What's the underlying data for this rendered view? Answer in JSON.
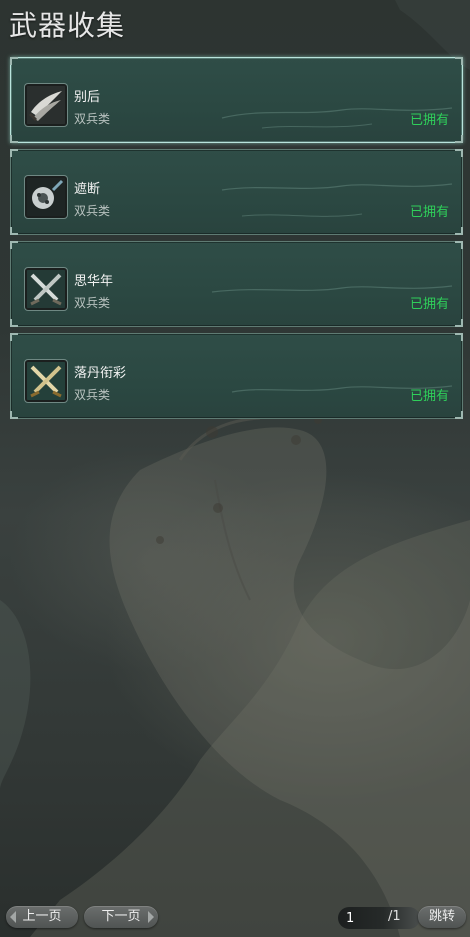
{
  "title": "武器收集",
  "weapons": [
    {
      "name": "别后",
      "type": "双兵类",
      "status": "已拥有",
      "icon": "twin-curved-blades-icon",
      "selected": true
    },
    {
      "name": "遮断",
      "type": "双兵类",
      "status": "已拥有",
      "icon": "twin-disc-blades-icon",
      "selected": false
    },
    {
      "name": "思华年",
      "type": "双兵类",
      "status": "已拥有",
      "icon": "crossed-swords-silver-icon",
      "selected": false
    },
    {
      "name": "落丹衔彩",
      "type": "双兵类",
      "status": "已拥有",
      "icon": "crossed-swords-gold-icon",
      "selected": false
    }
  ],
  "pager": {
    "prev_label": "上一页",
    "next_label": "下一页",
    "current_page": "1",
    "total_label": "/1",
    "jump_label": "跳转"
  },
  "colors": {
    "owned_status": "#2fcf5a",
    "card_bg": "#2d4a44",
    "selected_border": "#b9e4dc"
  }
}
